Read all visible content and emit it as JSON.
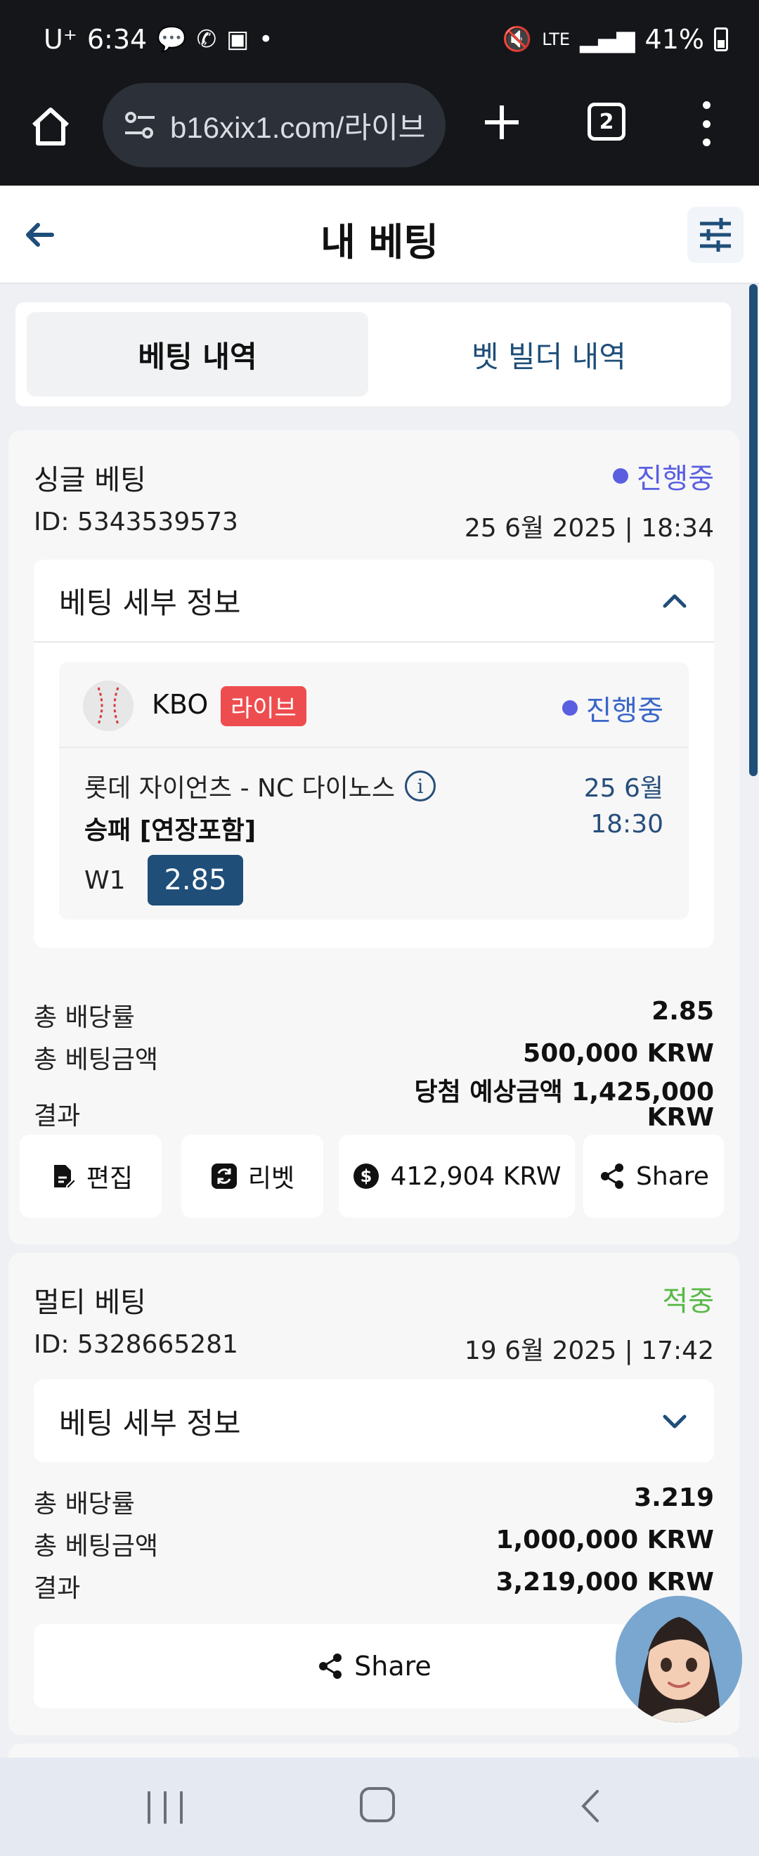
{
  "status_bar": {
    "carrier": "U⁺",
    "time": "6:34",
    "network": "LTE",
    "battery": "41%"
  },
  "browser": {
    "url": "b16xix1.com/라이브",
    "tab_count": "2"
  },
  "header": {
    "title": "내 베팅"
  },
  "tabs": [
    {
      "label": "베팅 내역",
      "active": true
    },
    {
      "label": "벳 빌더 내역",
      "active": false
    }
  ],
  "bet1": {
    "type": "싱글 베팅",
    "status": "진행중",
    "id": "ID: 5343539573",
    "date": "25 6월 2025 | 18:34",
    "details_label": "베팅 세부 정보",
    "event": {
      "league": "KBO",
      "live_badge": "라이브",
      "status": "진행중",
      "teams": "롯데 자이언츠 - NC 다이노스",
      "date": "25 6월",
      "market": "승패 [연장포함]",
      "time": "18:30",
      "pick": "W1",
      "odds": "2.85"
    },
    "summary": {
      "odds_label": "총 배당률",
      "odds_value": "2.85",
      "stake_label": "총 베팅금액",
      "stake_value": "500,000 KRW",
      "result_label": "결과",
      "result_value_line1": "당첨 예상금액 1,425,000",
      "result_value_line2": "KRW"
    },
    "actions": {
      "edit": "편집",
      "rebet": "리벳",
      "cashout": "412,904 KRW",
      "share": "Share"
    }
  },
  "bet2": {
    "type": "멀티 베팅",
    "status": "적중",
    "id": "ID: 5328665281",
    "date": "19 6월 2025 | 17:42",
    "details_label": "베팅 세부 정보",
    "summary": {
      "odds_label": "총 배당률",
      "odds_value": "3.219",
      "stake_label": "총 베팅금액",
      "stake_value": "1,000,000 KRW",
      "result_label": "결과",
      "result_value": "3,219,000 KRW"
    },
    "share": "Share"
  },
  "colors": {
    "accent": "#1f4e79",
    "status_live": "#5a5fe0",
    "status_win": "#58b946",
    "live_badge": "#ee4d4f"
  }
}
